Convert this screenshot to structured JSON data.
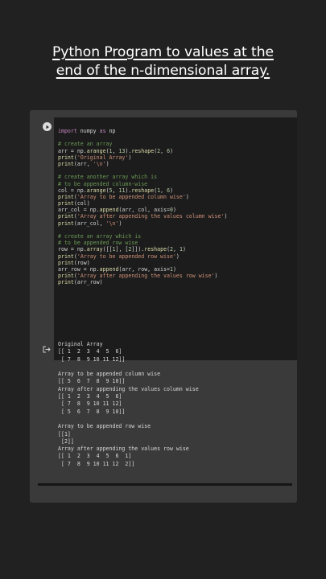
{
  "header": {
    "title_line1": "Python Program to values at the",
    "title_line2": "end of the n-dimensional array."
  },
  "code_lines": [
    [
      {
        "t": "import",
        "c": "kw"
      },
      {
        "t": " numpy "
      },
      {
        "t": "as",
        "c": "kw"
      },
      {
        "t": " np"
      }
    ],
    [],
    [
      {
        "t": "# create an array",
        "c": "cm"
      }
    ],
    [
      {
        "t": "arr = np."
      },
      {
        "t": "arange",
        "c": "fn"
      },
      {
        "t": "("
      },
      {
        "t": "1",
        "c": "num"
      },
      {
        "t": ", "
      },
      {
        "t": "13",
        "c": "num"
      },
      {
        "t": ")."
      },
      {
        "t": "reshape",
        "c": "fn"
      },
      {
        "t": "("
      },
      {
        "t": "2",
        "c": "num"
      },
      {
        "t": ", "
      },
      {
        "t": "6",
        "c": "num"
      },
      {
        "t": ")"
      }
    ],
    [
      {
        "t": "print",
        "c": "fn"
      },
      {
        "t": "("
      },
      {
        "t": "'Original Array'",
        "c": "str"
      },
      {
        "t": ")"
      }
    ],
    [
      {
        "t": "print",
        "c": "fn"
      },
      {
        "t": "(arr, "
      },
      {
        "t": "'\\n'",
        "c": "str"
      },
      {
        "t": ")"
      }
    ],
    [],
    [
      {
        "t": "# create another array which is",
        "c": "cm"
      }
    ],
    [
      {
        "t": "# to be appended column-wise",
        "c": "cm"
      }
    ],
    [
      {
        "t": "col = np."
      },
      {
        "t": "arange",
        "c": "fn"
      },
      {
        "t": "("
      },
      {
        "t": "5",
        "c": "num"
      },
      {
        "t": ", "
      },
      {
        "t": "11",
        "c": "num"
      },
      {
        "t": ")."
      },
      {
        "t": "reshape",
        "c": "fn"
      },
      {
        "t": "("
      },
      {
        "t": "1",
        "c": "num"
      },
      {
        "t": ", "
      },
      {
        "t": "6",
        "c": "num"
      },
      {
        "t": ")"
      }
    ],
    [
      {
        "t": "print",
        "c": "fn"
      },
      {
        "t": "("
      },
      {
        "t": "'Array to be appended column wise'",
        "c": "str"
      },
      {
        "t": ")"
      }
    ],
    [
      {
        "t": "print",
        "c": "fn"
      },
      {
        "t": "(col)"
      }
    ],
    [
      {
        "t": "arr_col = np."
      },
      {
        "t": "append",
        "c": "fn"
      },
      {
        "t": "(arr, col, axis="
      },
      {
        "t": "0",
        "c": "num"
      },
      {
        "t": ")"
      }
    ],
    [
      {
        "t": "print",
        "c": "fn"
      },
      {
        "t": "("
      },
      {
        "t": "'Array after appending the values column wise'",
        "c": "str"
      },
      {
        "t": ")"
      }
    ],
    [
      {
        "t": "print",
        "c": "fn"
      },
      {
        "t": "(arr_col, "
      },
      {
        "t": "'\\n'",
        "c": "str"
      },
      {
        "t": ")"
      }
    ],
    [],
    [
      {
        "t": "# create an array which is",
        "c": "cm"
      }
    ],
    [
      {
        "t": "# to be appended row wise",
        "c": "cm"
      }
    ],
    [
      {
        "t": "row = np."
      },
      {
        "t": "array",
        "c": "fn"
      },
      {
        "t": "([["
      },
      {
        "t": "1",
        "c": "num"
      },
      {
        "t": "], ["
      },
      {
        "t": "2",
        "c": "num"
      },
      {
        "t": "]])."
      },
      {
        "t": "reshape",
        "c": "fn"
      },
      {
        "t": "("
      },
      {
        "t": "2",
        "c": "num"
      },
      {
        "t": ", "
      },
      {
        "t": "1",
        "c": "num"
      },
      {
        "t": ")"
      }
    ],
    [
      {
        "t": "print",
        "c": "fn"
      },
      {
        "t": "("
      },
      {
        "t": "'Array to be appended row wise'",
        "c": "str"
      },
      {
        "t": ")"
      }
    ],
    [
      {
        "t": "print",
        "c": "fn"
      },
      {
        "t": "(row)"
      }
    ],
    [
      {
        "t": "arr_row = np."
      },
      {
        "t": "append",
        "c": "fn"
      },
      {
        "t": "(arr, row, axis="
      },
      {
        "t": "1",
        "c": "num"
      },
      {
        "t": ")"
      }
    ],
    [
      {
        "t": "print",
        "c": "fn"
      },
      {
        "t": "("
      },
      {
        "t": "'Array after appending the values row wise'",
        "c": "str"
      },
      {
        "t": ")"
      }
    ],
    [
      {
        "t": "print",
        "c": "fn"
      },
      {
        "t": "(arr_row)"
      }
    ]
  ],
  "output_text": "Original Array\n[[ 1  2  3  4  5  6]\n [ 7  8  9 10 11 12]]\n\nArray to be appended column wise\n[[ 5  6  7  8  9 10]]\nArray after appending the values column wise\n[[ 1  2  3  4  5  6]\n [ 7  8  9 10 11 12]\n [ 5  6  7  8  9 10]]\n\nArray to be appended row wise\n[[1]\n [2]]\nArray after appending the values row wise\n[[ 1  2  3  4  5  6  1]\n [ 7  8  9 10 11 12  2]]",
  "icons": {
    "run": "play-icon",
    "output": "output-redirect-icon"
  }
}
